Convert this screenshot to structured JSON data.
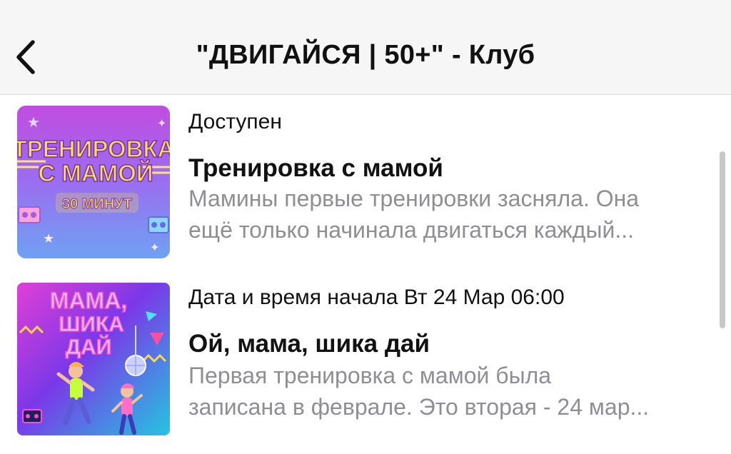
{
  "header": {
    "back_icon": "chevron-left-icon",
    "title": "\"ДВИГАЙСЯ | 50+\" - Клуб"
  },
  "items": [
    {
      "status": "Доступен",
      "title": "Тренировка с мамой",
      "desc_line1": "Мамины первые тренировки засняла. Она",
      "desc_line2": "ещё только начинала двигаться каждый...",
      "thumb": {
        "line1": "ТРЕНИРОВКА",
        "line2": "С МАМОЙ",
        "line3": "30 МИНУТ"
      }
    },
    {
      "status": "Дата и время начала Вт 24 Мар 06:00",
      "title": "Ой, мама, шика дай",
      "desc_line1": "Первая тренировка с мамой была",
      "desc_line2": "записана в феврале. Это вторая - 24 мар...",
      "thumb": {
        "line1": "МАМА,",
        "line2": "ШИКА",
        "line3": "ДАЙ"
      }
    }
  ]
}
